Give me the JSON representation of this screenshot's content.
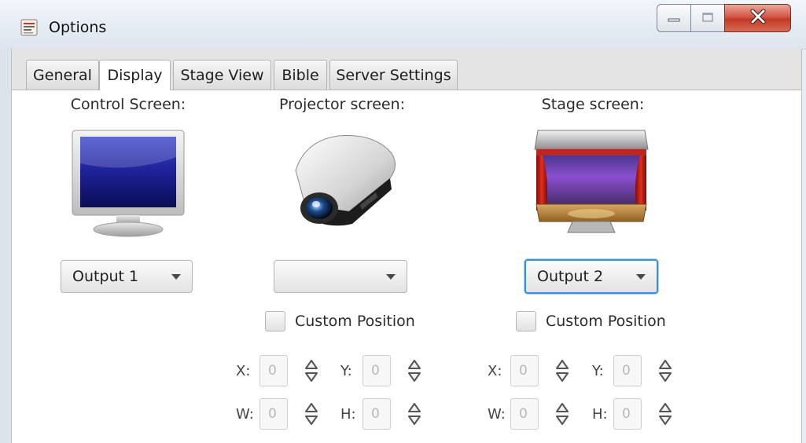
{
  "window": {
    "title": "Options",
    "icon": "options-app-icon"
  },
  "tabs": [
    {
      "label": "General",
      "selected": false
    },
    {
      "label": "Display",
      "selected": true
    },
    {
      "label": "Stage View",
      "selected": false
    },
    {
      "label": "Bible",
      "selected": false
    },
    {
      "label": "Server Settings",
      "selected": false
    }
  ],
  "display": {
    "control": {
      "label": "Control Screen:",
      "icon": "monitor-icon",
      "output": "Output 1"
    },
    "projector": {
      "label": "Projector screen:",
      "icon": "projector-icon",
      "output": "",
      "custom_position_label": "Custom Position",
      "custom_position_checked": false,
      "x_label": "X:",
      "x_value": "0",
      "y_label": "Y:",
      "y_value": "0",
      "w_label": "W:",
      "w_value": "0",
      "h_label": "H:",
      "h_value": "0"
    },
    "stage": {
      "label": "Stage screen:",
      "icon": "theater-stage-icon",
      "output": "Output 2",
      "custom_position_label": "Custom Position",
      "custom_position_checked": false,
      "x_label": "X:",
      "x_value": "0",
      "y_label": "Y:",
      "y_value": "0",
      "w_label": "W:",
      "w_value": "0",
      "h_label": "H:",
      "h_value": "0"
    }
  },
  "colors": {
    "focus_ring": "#3c8ed8",
    "close_button": "#c23a27"
  }
}
